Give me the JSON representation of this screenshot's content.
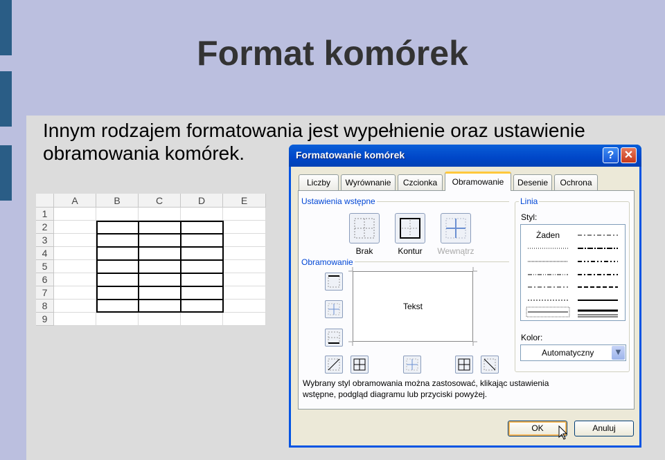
{
  "slide": {
    "title": "Format komórek",
    "body_line1": "Innym rodzajem formatowania jest wypełnienie oraz ustawienie",
    "body_line2": "obramowania komórek."
  },
  "spreadsheet": {
    "columns": [
      "A",
      "B",
      "C",
      "D",
      "E"
    ],
    "rows": [
      "1",
      "2",
      "3",
      "4",
      "5",
      "6",
      "7",
      "8",
      "9"
    ]
  },
  "dialog": {
    "title": "Formatowanie komórek",
    "help_label": "?",
    "close_label": "✕",
    "tabs": [
      "Liczby",
      "Wyrównanie",
      "Czcionka",
      "Obramowanie",
      "Desenie",
      "Ochrona"
    ],
    "active_tab": "Obramowanie",
    "presets_group": "Ustawienia wstępne",
    "presets": [
      "Brak",
      "Kontur",
      "Wewnątrz"
    ],
    "border_group": "Obramowanie",
    "preview_text": "Tekst",
    "line_group": "Linia",
    "style_label": "Styl:",
    "style_none": "Żaden",
    "color_label": "Kolor:",
    "color_value": "Automatyczny",
    "info_text_1": "Wybrany styl obramowania można zastosować, klikając ustawienia",
    "info_text_2": "wstępne, podgląd diagramu lub przyciski powyżej.",
    "ok_label": "OK",
    "cancel_label": "Anuluj"
  }
}
